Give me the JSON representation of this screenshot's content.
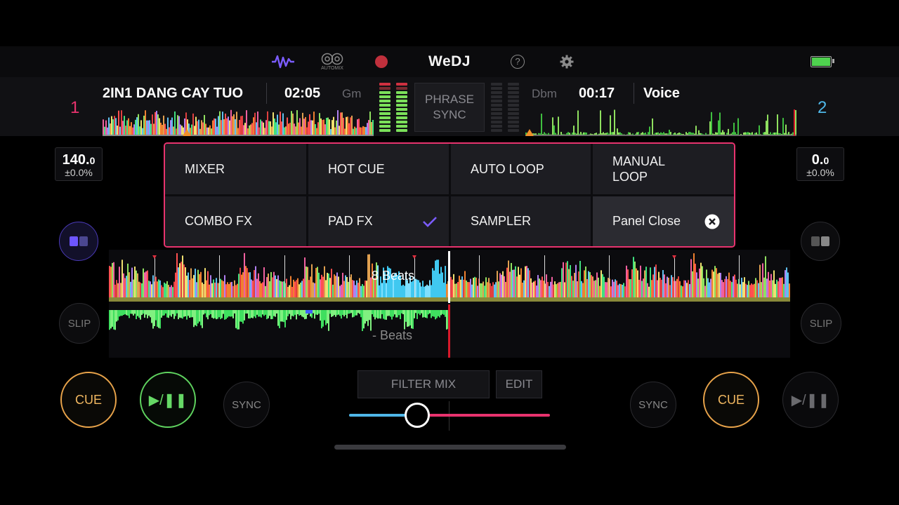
{
  "toolbar": {
    "automix_label": "AUTOMIX",
    "brand": "WeDJ",
    "help": "?",
    "icons": [
      "waveform-icon",
      "automix-icon",
      "record-icon",
      "help-icon",
      "gear-icon",
      "battery-icon"
    ]
  },
  "deck1": {
    "number": "1",
    "title": "2IN1 DANG CAY TUO",
    "time": "02:05",
    "key": "Gm",
    "bpm_whole": "140.",
    "bpm_decimal": "0",
    "pitch": "±0.0%",
    "beats_label": "8 Beats",
    "slip": "SLIP",
    "cue": "CUE",
    "play": "▶/❚❚",
    "sync": "SYNC",
    "color": "#e8336e"
  },
  "deck2": {
    "number": "2",
    "title": "Voice",
    "time": "00:17",
    "key": "Dbm",
    "bpm_whole": "0.",
    "bpm_decimal": "0",
    "pitch": "±0.0%",
    "beats_label": "- Beats",
    "slip": "SLIP",
    "cue": "CUE",
    "play": "▶/❚❚",
    "sync": "SYNC",
    "color": "#4fb7e8"
  },
  "phrase_sync": {
    "line1": "PHRASE",
    "line2": "SYNC"
  },
  "panel": {
    "items": [
      {
        "label": "MIXER"
      },
      {
        "label": "HOT CUE"
      },
      {
        "label": "AUTO LOOP"
      },
      {
        "label": "MANUAL\nLOOP"
      },
      {
        "label": "COMBO FX"
      },
      {
        "label": "PAD FX",
        "selected": true
      },
      {
        "label": "SAMPLER"
      },
      {
        "label": "Panel Close"
      }
    ],
    "border_color": "#e8336e",
    "check_color": "#7b5cff"
  },
  "mixer": {
    "filter_mix": "FILTER MIX",
    "edit": "EDIT",
    "crossfader_position": 0.34
  },
  "colors": {
    "accent_pink": "#e8336e",
    "accent_blue": "#4fb7e8",
    "cue_orange": "#e8a34a",
    "play_green": "#5fd35f"
  }
}
